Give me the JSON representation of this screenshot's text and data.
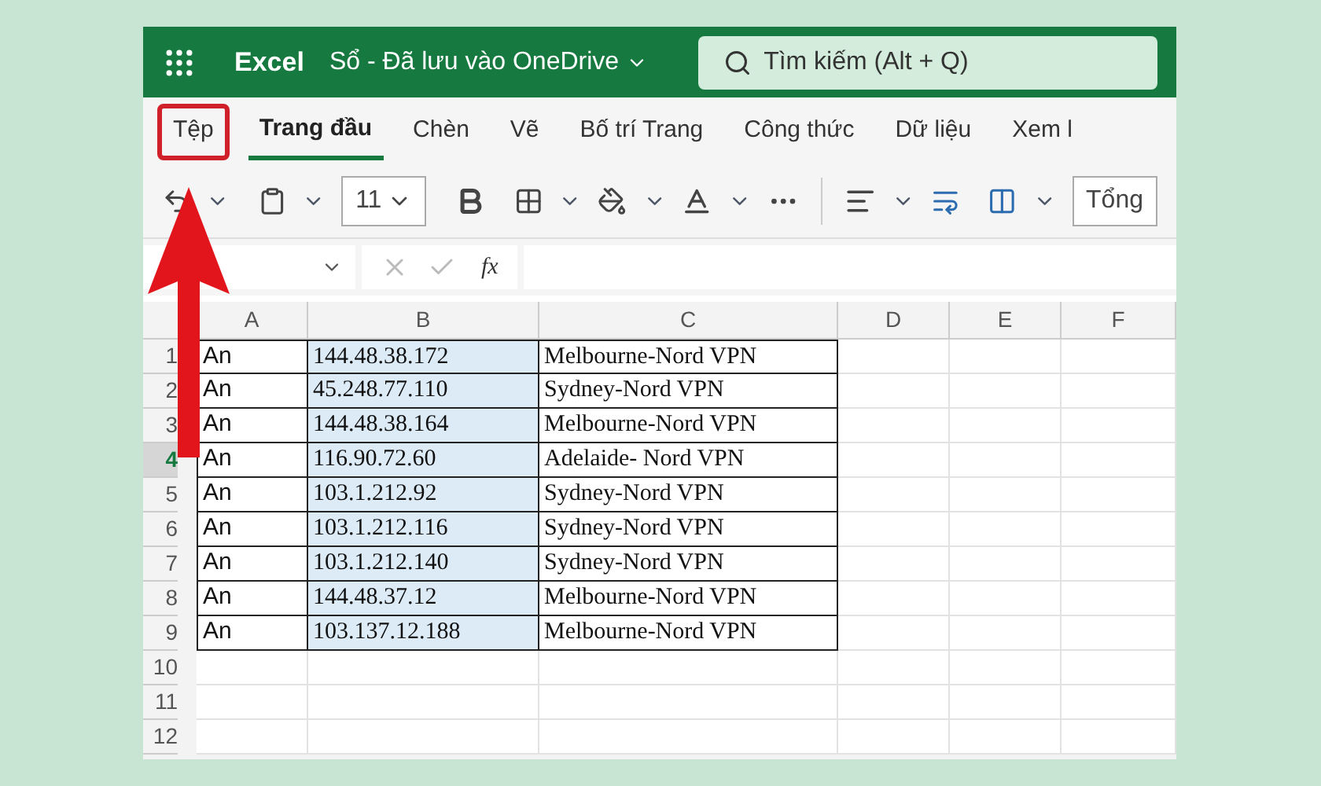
{
  "app": {
    "name": "Excel",
    "document": "Sổ - Đã lưu vào OneDrive"
  },
  "search": {
    "placeholder": "Tìm kiếm (Alt + Q)"
  },
  "tabs": [
    {
      "label": "Tệp",
      "selected": false,
      "annotated": true
    },
    {
      "label": "Trang đầu",
      "selected": true,
      "annotated": false
    },
    {
      "label": "Chèn",
      "selected": false,
      "annotated": false
    },
    {
      "label": "Vẽ",
      "selected": false,
      "annotated": false
    },
    {
      "label": "Bố trí Trang",
      "selected": false,
      "annotated": false
    },
    {
      "label": "Công thức",
      "selected": false,
      "annotated": false
    },
    {
      "label": "Dữ liệu",
      "selected": false,
      "annotated": false
    },
    {
      "label": "Xem l",
      "selected": false,
      "annotated": false
    }
  ],
  "toolbar": {
    "font_size": "11",
    "autosum_label": "Tổng"
  },
  "formula_bar": {
    "function_label": "fx"
  },
  "columns": [
    "A",
    "B",
    "C",
    "D",
    "E",
    "F"
  ],
  "rows": [
    {
      "number": "1",
      "selected": false,
      "cells": [
        "An",
        "144.48.38.172",
        "Melbourne-Nord VPN"
      ]
    },
    {
      "number": "2",
      "selected": false,
      "cells": [
        "An",
        "45.248.77.110",
        "Sydney-Nord VPN"
      ]
    },
    {
      "number": "3",
      "selected": false,
      "cells": [
        "An",
        "144.48.38.164",
        "Melbourne-Nord VPN"
      ]
    },
    {
      "number": "4",
      "selected": true,
      "cells": [
        "An",
        "116.90.72.60",
        "Adelaide- Nord VPN"
      ]
    },
    {
      "number": "5",
      "selected": false,
      "cells": [
        "An",
        "103.1.212.92",
        "Sydney-Nord VPN"
      ]
    },
    {
      "number": "6",
      "selected": false,
      "cells": [
        "An",
        "103.1.212.116",
        "Sydney-Nord VPN"
      ]
    },
    {
      "number": "7",
      "selected": false,
      "cells": [
        "An",
        "103.1.212.140",
        "Sydney-Nord VPN"
      ]
    },
    {
      "number": "8",
      "selected": false,
      "cells": [
        "An",
        "144.48.37.12",
        "Melbourne-Nord VPN"
      ]
    },
    {
      "number": "9",
      "selected": false,
      "cells": [
        "An",
        "103.137.12.188",
        "Melbourne-Nord VPN"
      ]
    },
    {
      "number": "10",
      "selected": false,
      "cells": []
    },
    {
      "number": "11",
      "selected": false,
      "cells": []
    },
    {
      "number": "12",
      "selected": false,
      "cells": []
    }
  ]
}
